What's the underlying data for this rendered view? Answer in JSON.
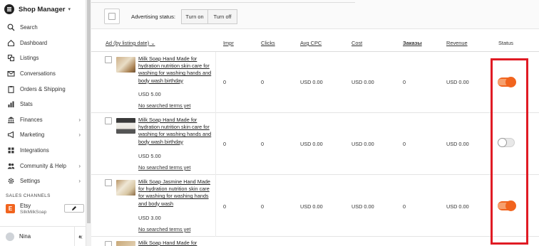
{
  "brand": {
    "title": "Shop Manager"
  },
  "nav": [
    {
      "label": "Search",
      "icon": "search-icon",
      "chevron": false
    },
    {
      "label": "Dashboard",
      "icon": "home-icon",
      "chevron": false
    },
    {
      "label": "Listings",
      "icon": "listings-icon",
      "chevron": false
    },
    {
      "label": "Conversations",
      "icon": "mail-icon",
      "chevron": false
    },
    {
      "label": "Orders & Shipping",
      "icon": "clipboard-icon",
      "chevron": false
    },
    {
      "label": "Stats",
      "icon": "stats-icon",
      "chevron": false
    },
    {
      "label": "Finances",
      "icon": "bank-icon",
      "chevron": true
    },
    {
      "label": "Marketing",
      "icon": "megaphone-icon",
      "chevron": true
    },
    {
      "label": "Integrations",
      "icon": "grid-icon",
      "chevron": false
    },
    {
      "label": "Community & Help",
      "icon": "people-icon",
      "chevron": true
    },
    {
      "label": "Settings",
      "icon": "gear-icon",
      "chevron": true
    }
  ],
  "sales_channels": {
    "title": "SALES CHANNELS",
    "channel": {
      "badge": "E",
      "name": "Etsy",
      "shop": "SilkMilkSoap"
    }
  },
  "user": {
    "name": "Nina"
  },
  "toolbar": {
    "advertising_status_label": "Advertising status:",
    "turn_on_label": "Turn on",
    "turn_off_label": "Turn off"
  },
  "table": {
    "headers": {
      "ad": "Ad (by listing date)",
      "impr": "Impr",
      "clicks": "Clicks",
      "avg_cpc": "Avg CPC",
      "cost": "Cost",
      "orders": "Заказы",
      "revenue": "Revenue",
      "status": "Status"
    },
    "rows": [
      {
        "title": "Milk Soap Hand Made for hydration nutrition skin care for washing for washing hands and body wash birthday",
        "price": "USD 5.00",
        "terms": "No searched terms yet",
        "impr": "0",
        "clicks": "0",
        "avg_cpc": "USD 0.00",
        "cost": "USD 0.00",
        "orders": "0",
        "revenue": "USD 0.00",
        "status_on": true
      },
      {
        "title": "Milk Soap Hand Made for hydration nutrition skin care for washing for washing hands and body wash birthday",
        "price": "USD 5.00",
        "terms": "No searched terms yet",
        "impr": "0",
        "clicks": "0",
        "avg_cpc": "USD 0.00",
        "cost": "USD 0.00",
        "orders": "0",
        "revenue": "USD 0.00",
        "status_on": false
      },
      {
        "title": "Milk Soap Jasmine Hand Made for hydration nutrition skin care for washing for washing hands and body wash",
        "price": "USD 3.00",
        "terms": "No searched terms yet",
        "impr": "0",
        "clicks": "0",
        "avg_cpc": "USD 0.00",
        "cost": "USD 0.00",
        "orders": "0",
        "revenue": "USD 0.00",
        "status_on": true
      },
      {
        "title": "Milk Soap Hand Made for"
      }
    ]
  },
  "colors": {
    "accent": "#f1641e",
    "highlight": "#e01b24"
  }
}
